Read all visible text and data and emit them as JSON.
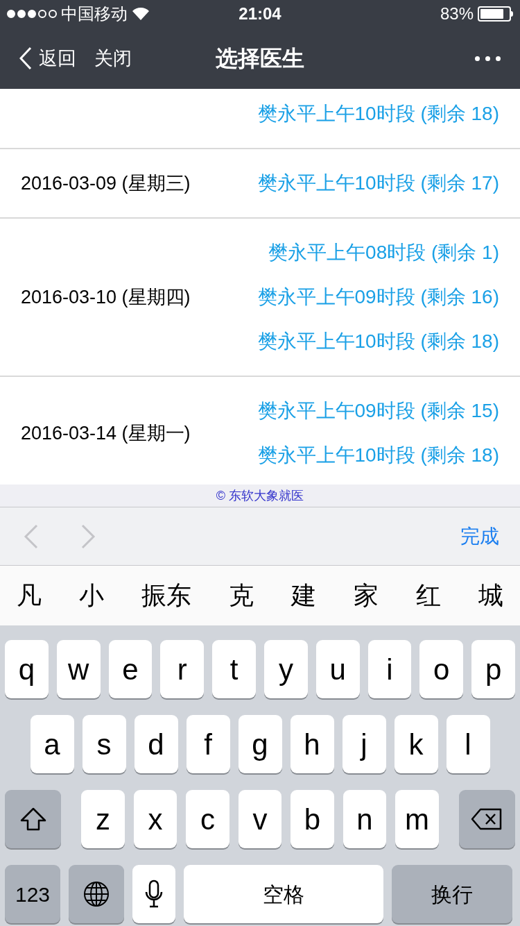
{
  "status_bar": {
    "carrier": "中国移动",
    "time": "21:04",
    "battery": "83%"
  },
  "nav_bar": {
    "back": "返回",
    "close": "关闭",
    "title": "选择医生"
  },
  "schedule": [
    {
      "slots": [
        "樊永平上午10时段 (剩余 18)"
      ]
    },
    {
      "date": "2016-03-09 (星期三)",
      "slots": [
        "樊永平上午10时段 (剩余 17)"
      ]
    },
    {
      "date": "2016-03-10 (星期四)",
      "slots": [
        "樊永平上午08时段 (剩余 1)",
        "樊永平上午09时段 (剩余 16)",
        "樊永平上午10时段 (剩余 18)"
      ]
    },
    {
      "date": "2016-03-14 (星期一)",
      "slots": [
        "樊永平上午09时段 (剩余 15)",
        "樊永平上午10时段 (剩余 18)"
      ]
    }
  ],
  "footer": "© 东软大象就医",
  "input_toolbar": {
    "prev_disabled": true,
    "next_disabled": true,
    "done": "完成"
  },
  "candidates": [
    "凡",
    "小",
    "振东",
    "克",
    "建",
    "家",
    "红",
    "城"
  ],
  "keyboard": {
    "rows": [
      {
        "keys": [
          {
            "kind": "letter",
            "label": "q"
          },
          {
            "kind": "letter",
            "label": "w"
          },
          {
            "kind": "letter",
            "label": "e"
          },
          {
            "kind": "letter",
            "label": "r"
          },
          {
            "kind": "letter",
            "label": "t"
          },
          {
            "kind": "letter",
            "label": "y"
          },
          {
            "kind": "letter",
            "label": "u"
          },
          {
            "kind": "letter",
            "label": "i"
          },
          {
            "kind": "letter",
            "label": "o"
          },
          {
            "kind": "letter",
            "label": "p"
          }
        ]
      },
      {
        "keys": [
          {
            "kind": "letter",
            "label": "a"
          },
          {
            "kind": "letter",
            "label": "s"
          },
          {
            "kind": "letter",
            "label": "d"
          },
          {
            "kind": "letter",
            "label": "f"
          },
          {
            "kind": "letter",
            "label": "g"
          },
          {
            "kind": "letter",
            "label": "h"
          },
          {
            "kind": "letter",
            "label": "j"
          },
          {
            "kind": "letter",
            "label": "k"
          },
          {
            "kind": "letter",
            "label": "l"
          }
        ]
      },
      {
        "keys": [
          {
            "kind": "shift"
          },
          {
            "kind": "letter",
            "label": "z"
          },
          {
            "kind": "letter",
            "label": "x"
          },
          {
            "kind": "letter",
            "label": "c"
          },
          {
            "kind": "letter",
            "label": "v"
          },
          {
            "kind": "letter",
            "label": "b"
          },
          {
            "kind": "letter",
            "label": "n"
          },
          {
            "kind": "letter",
            "label": "m"
          },
          {
            "kind": "delete"
          }
        ]
      },
      {
        "keys": [
          {
            "kind": "numbers",
            "label": "123"
          },
          {
            "kind": "globe"
          },
          {
            "kind": "mic"
          },
          {
            "kind": "space",
            "label": "空格"
          },
          {
            "kind": "return",
            "label": "换行"
          }
        ]
      }
    ]
  }
}
